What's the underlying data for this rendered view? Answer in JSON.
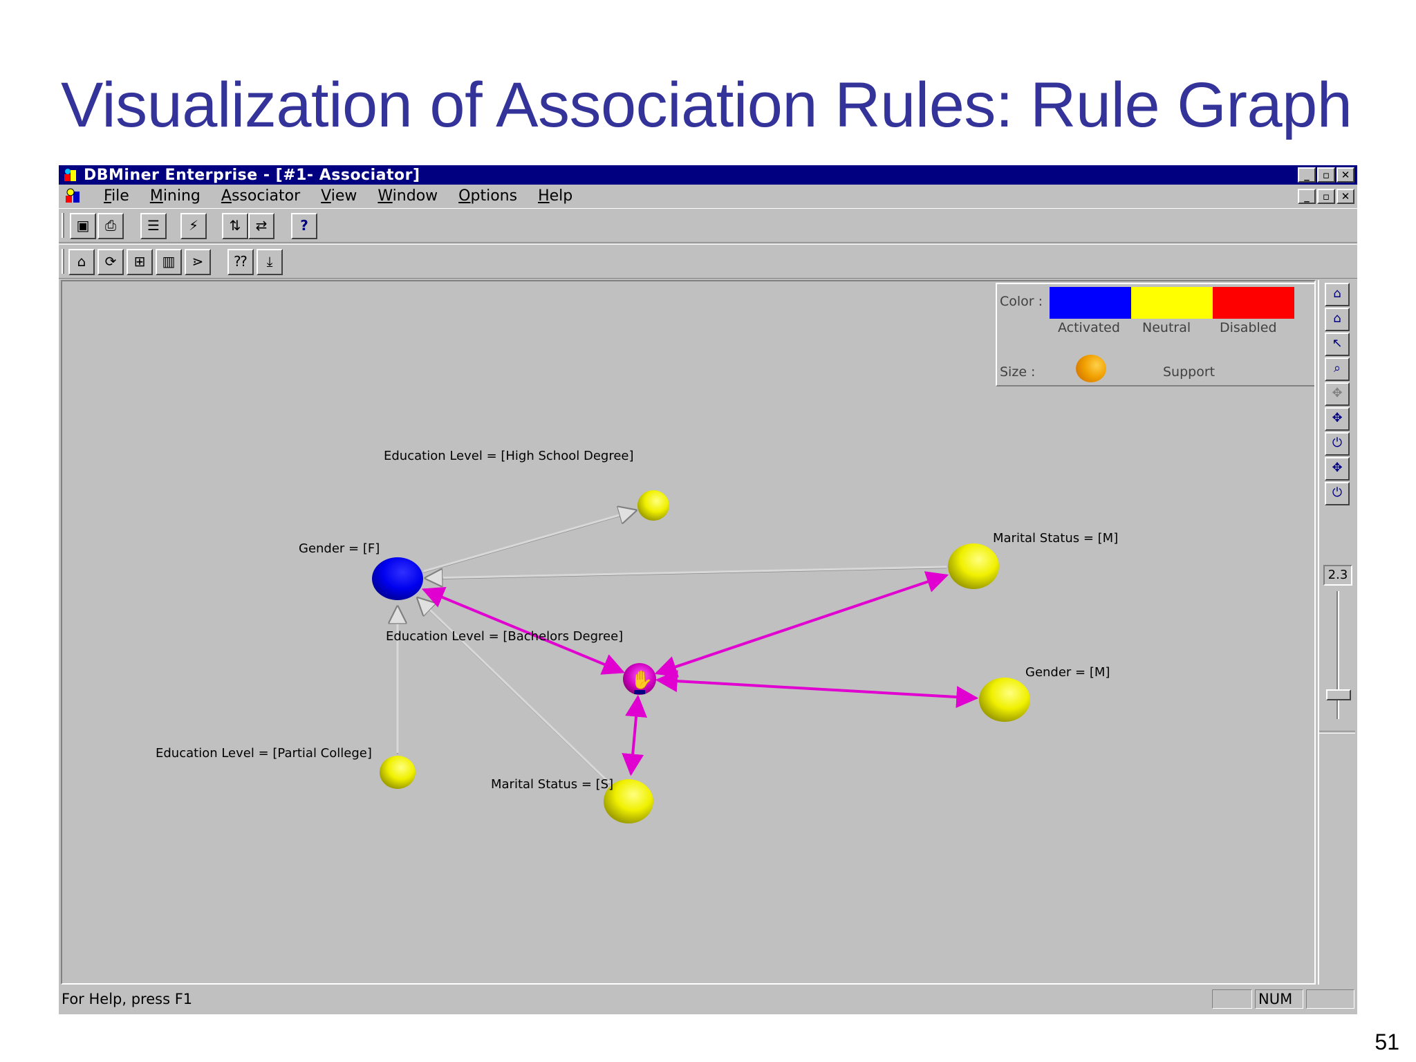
{
  "slide": {
    "title": "Visualization of Association Rules: Rule Graph",
    "page_number": "51"
  },
  "window": {
    "title": "DBMiner Enterprise - [#1- Associator]",
    "controls": {
      "minimize": "_",
      "restore": "▫",
      "close": "✕"
    }
  },
  "menu": {
    "items": [
      {
        "underline": "F",
        "rest": "ile"
      },
      {
        "underline": "M",
        "rest": "ining"
      },
      {
        "underline": "A",
        "rest": "ssociator"
      },
      {
        "underline": "V",
        "rest": "iew"
      },
      {
        "underline": "W",
        "rest": "indow"
      },
      {
        "underline": "O",
        "rest": "ptions"
      },
      {
        "underline": "H",
        "rest": "elp"
      }
    ]
  },
  "toolbar1": {
    "buttons": [
      {
        "icon": "save-icon",
        "glyph": "▣"
      },
      {
        "icon": "print-icon",
        "glyph": "⎙"
      },
      {
        "icon": "properties-icon",
        "glyph": "☰"
      },
      {
        "icon": "wand-icon",
        "glyph": "⚡"
      },
      {
        "icon": "sort-icon",
        "glyph": "⇅"
      },
      {
        "icon": "swap-icon",
        "glyph": "⇄"
      },
      {
        "icon": "help-icon",
        "glyph": "?"
      }
    ]
  },
  "toolbar2": {
    "buttons": [
      {
        "icon": "settings-icon",
        "glyph": "⌂"
      },
      {
        "icon": "refresh-icon",
        "glyph": "⟳"
      },
      {
        "icon": "grid-icon",
        "glyph": "⊞"
      },
      {
        "icon": "bar-chart-icon",
        "glyph": "▥"
      },
      {
        "icon": "rule-graph-icon",
        "glyph": "⋗"
      },
      {
        "icon": "query-icon",
        "glyph": "⁇"
      },
      {
        "icon": "sort-list-icon",
        "glyph": "⤓"
      }
    ]
  },
  "legend": {
    "color_label": "Color :",
    "size_label": "Size :",
    "activated_label": "Activated",
    "neutral_label": "Neutral",
    "disabled_label": "Disabled",
    "support_label": "Support",
    "activated_color": "#0000ff",
    "neutral_color": "#ffff00",
    "disabled_color": "#ff0000"
  },
  "graph": {
    "nodes": [
      {
        "id": "gender-f",
        "label": "Gender = [F]",
        "state": "activated"
      },
      {
        "id": "edu-high-school",
        "label": "Education Level = [High School Degree]",
        "state": "neutral"
      },
      {
        "id": "marital-m",
        "label": "Marital Status = [M]",
        "state": "neutral"
      },
      {
        "id": "edu-bachelors",
        "label": "Education Level = [Bachelors Degree]",
        "state": "rule"
      },
      {
        "id": "gender-m",
        "label": "Gender = [M]",
        "state": "neutral"
      },
      {
        "id": "edu-partial-college",
        "label": "Education Level = [Partial College]",
        "state": "neutral"
      },
      {
        "id": "marital-s",
        "label": "Marital Status = [S]",
        "state": "neutral"
      }
    ],
    "edges": [
      {
        "from": "gender-f",
        "to": "edu-high-school",
        "highlight": false
      },
      {
        "from": "marital-m",
        "to": "gender-f",
        "highlight": false
      },
      {
        "from": "edu-partial-college",
        "to": "gender-f",
        "highlight": false
      },
      {
        "from": "marital-s",
        "to": "gender-f",
        "highlight": false
      },
      {
        "from": "edu-bachelors",
        "to": "gender-f",
        "highlight": true
      },
      {
        "from": "edu-bachelors",
        "to": "marital-m",
        "highlight": true
      },
      {
        "from": "edu-bachelors",
        "to": "gender-m",
        "highlight": true
      },
      {
        "from": "edu-bachelors",
        "to": "marital-s",
        "highlight": true
      }
    ]
  },
  "right_panel": {
    "zoom_value": "2.3",
    "buttons": [
      {
        "icon": "home-icon",
        "glyph": "⌂"
      },
      {
        "icon": "home-reset-icon",
        "glyph": "⌂"
      },
      {
        "icon": "pointer-icon",
        "glyph": "↖"
      },
      {
        "icon": "zoom-icon",
        "glyph": "⌕"
      },
      {
        "icon": "pan-disabled-icon",
        "glyph": "✥"
      },
      {
        "icon": "move-icon",
        "glyph": "✥"
      },
      {
        "icon": "toggle-onoff-icon",
        "glyph": "⏻"
      },
      {
        "icon": "move-alt-icon",
        "glyph": "✥"
      },
      {
        "icon": "toggle-onoff-alt-icon",
        "glyph": "⏻"
      }
    ]
  },
  "status": {
    "help": "For Help, press F1",
    "num": "NUM"
  }
}
